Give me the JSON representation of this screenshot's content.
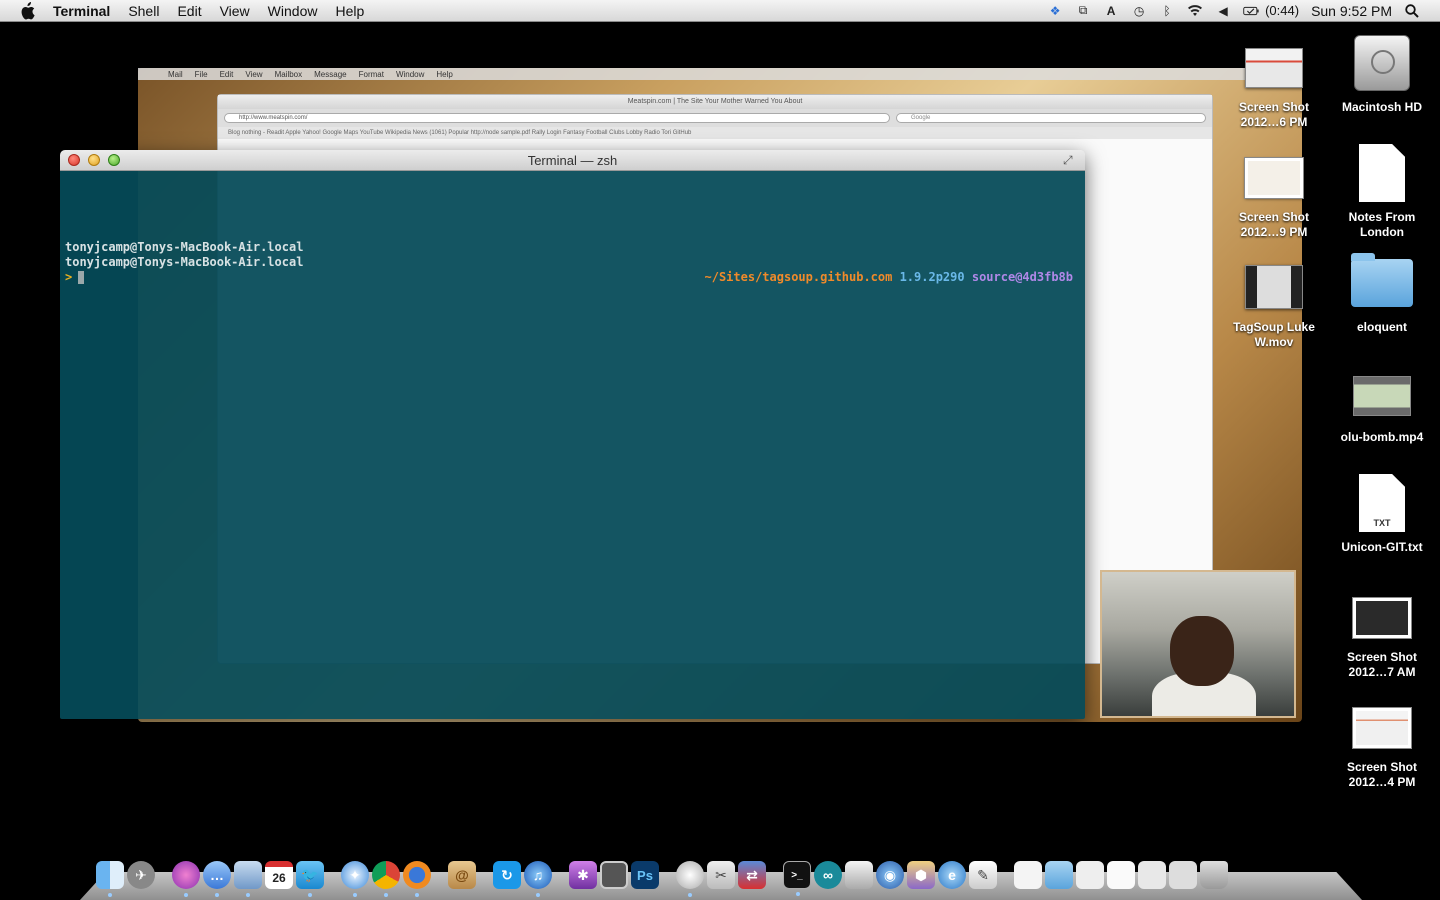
{
  "menubar": {
    "app_name": "Terminal",
    "items": [
      "Shell",
      "Edit",
      "View",
      "Window",
      "Help"
    ],
    "battery": "(0:44)",
    "clock": "Sun 9:52 PM"
  },
  "background_windows": {
    "mail_menu": [
      "Mail",
      "File",
      "Edit",
      "View",
      "Mailbox",
      "Message",
      "Format",
      "Window",
      "Help"
    ],
    "safari_title": "Meatspin.com | The Site Your Mother Warned You About",
    "safari_url": "http://www.meatspin.com/",
    "safari_search": "Google",
    "safari_bookmarks": "Blog nothing - Readit   Apple   Yahoo!   Google Maps   YouTube   Wikipedia   News (1061)   Popular   http://node   sample.pdf   Rally Login   Fantasy Football   Clubs Lobby   Radio Tori   GitHub"
  },
  "terminal": {
    "title": "Terminal — zsh",
    "lines": [
      "tonyjcamp@Tonys-MacBook-Air.local",
      "tonyjcamp@Tonys-MacBook-Air.local"
    ],
    "prompt_symbol": ">",
    "right_prompt": {
      "path": "~/Sites/tagsoup.github.com",
      "version": "1.9.2p290",
      "branch": "source@4d3fb8b"
    }
  },
  "desktop_icons": [
    {
      "label": "Screen Shot 2012…6 PM"
    },
    {
      "label": "Macintosh HD"
    },
    {
      "label": "Screen Shot 2012…9 PM"
    },
    {
      "label": "Notes From London"
    },
    {
      "label": "TagSoup Luke W.mov"
    },
    {
      "label": "eloquent"
    },
    {
      "label": "olu-bomb.mp4"
    },
    {
      "label": "Unicon-GIT.txt",
      "badge": "TXT"
    },
    {
      "label": "Screen Shot 2012…7 AM"
    },
    {
      "label": "Screen Shot 2012…4 PM"
    }
  ],
  "dock": {
    "calendar_day": "26",
    "photoshop_label": "Ps"
  }
}
